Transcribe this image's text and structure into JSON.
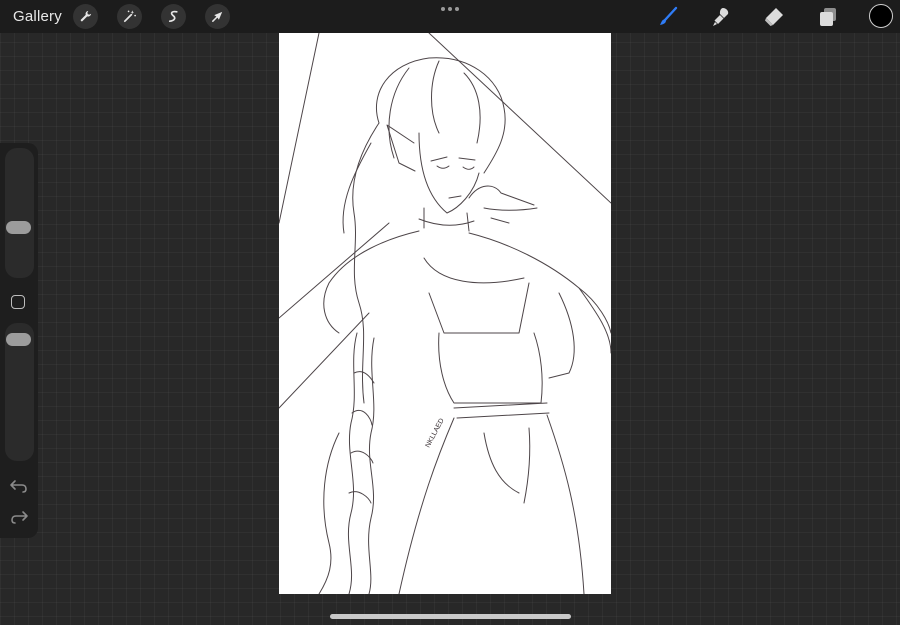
{
  "topbar": {
    "gallery_label": "Gallery",
    "left_tools": [
      "wrench-icon",
      "magic-wand-icon",
      "selection-icon",
      "transform-arrow-icon"
    ],
    "right_tools": [
      "brush-icon",
      "smudge-icon",
      "eraser-icon",
      "layers-icon"
    ],
    "active_tool": "brush-icon",
    "active_tool_color": "#2f7cf6",
    "current_color": "#000000"
  },
  "sidebar": {
    "brush_size_level": 0.38,
    "brush_opacity_level": 0.92,
    "modify_button": "square-outline-icon",
    "undo": "undo-icon",
    "redo": "redo-icon"
  },
  "canvas": {
    "signature_text": "NKLLAED",
    "background": "#ffffff",
    "stroke_color": "#3a3135"
  }
}
